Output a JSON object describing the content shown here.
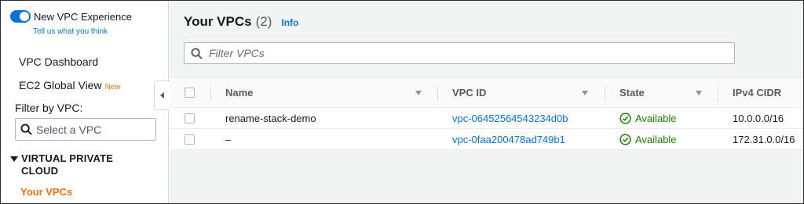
{
  "sidebar": {
    "toggle_label": "New VPC Experience",
    "feedback_link": "Tell us what you think",
    "nav": {
      "dashboard": "VPC Dashboard",
      "ec2_global_view": "EC2 Global View",
      "new_badge": "New"
    },
    "filter_label": "Filter by VPC:",
    "vpc_select_placeholder": "Select a VPC",
    "section_title_line1": "VIRTUAL PRIVATE",
    "section_title_line2": "CLOUD",
    "active_item": "Your VPCs"
  },
  "main": {
    "title": "Your VPCs",
    "count": "(2)",
    "info_link": "Info",
    "filter_placeholder": "Filter VPCs",
    "columns": {
      "name": "Name",
      "vpc_id": "VPC ID",
      "state": "State",
      "ipv4_cidr": "IPv4 CIDR"
    },
    "rows": [
      {
        "name": "rename-stack-demo",
        "vpc_id": "vpc-06452564543234d0b",
        "state": "Available",
        "cidr": "10.0.0.0/16"
      },
      {
        "name": "–",
        "vpc_id": "vpc-0faa200478ad749b1",
        "state": "Available",
        "cidr": "172.31.0.0/16"
      }
    ]
  },
  "colors": {
    "accent": "#0972d3",
    "active_nav": "#ec7211",
    "success": "#1d8102"
  },
  "icons": [
    "toggle-switch",
    "search-icon",
    "caret-down-icon",
    "caret-left-icon",
    "sort-icon",
    "check-circle-icon"
  ]
}
